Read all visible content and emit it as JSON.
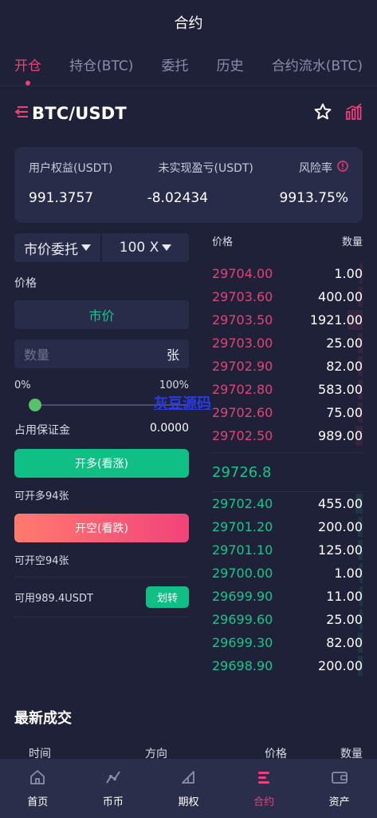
{
  "header": {
    "title": "合约"
  },
  "tabs": [
    {
      "label": "开仓",
      "active": true
    },
    {
      "label": "持仓(BTC)",
      "active": false
    },
    {
      "label": "委托",
      "active": false
    },
    {
      "label": "历史",
      "active": false
    },
    {
      "label": "合约流水(BTC)",
      "active": false
    }
  ],
  "pair": {
    "name": "BTC/USDT"
  },
  "account": {
    "equity_label": "用户权益(USDT)",
    "equity_value": "991.3757",
    "unrealized_label": "未实现盈亏(USDT)",
    "unrealized_value": "-8.02434",
    "risk_label": "风险率",
    "risk_value": "9913.75%"
  },
  "order_form": {
    "type_label": "市价委托",
    "leverage_label": "100 X",
    "price_label": "价格",
    "market_text": "市价",
    "qty_placeholder": "数量",
    "qty_unit": "张",
    "pct_min": "0%",
    "pct_max": "100%",
    "slider_value": 0,
    "margin_label": "占用保证金",
    "margin_value": "0.0000",
    "long_button": "开多(看涨)",
    "long_avail": "可开多94张",
    "short_button": "开空(看跌)",
    "short_avail": "可开空94张",
    "usable": "可用989.4USDT",
    "transfer_button": "划转"
  },
  "orderbook": {
    "price_header": "价格",
    "qty_header": "数量",
    "asks": [
      {
        "price": "29704.00",
        "qty": "1.00",
        "depth": 0.02
      },
      {
        "price": "29703.60",
        "qty": "400.00",
        "depth": 0.03
      },
      {
        "price": "29703.50",
        "qty": "1921.00",
        "depth": 0.1
      },
      {
        "price": "29703.00",
        "qty": "25.00",
        "depth": 0.03
      },
      {
        "price": "29702.90",
        "qty": "82.00",
        "depth": 0.03
      },
      {
        "price": "29702.80",
        "qty": "583.00",
        "depth": 0.03
      },
      {
        "price": "29702.60",
        "qty": "75.00",
        "depth": 0.03
      },
      {
        "price": "29702.50",
        "qty": "989.00",
        "depth": 0.05
      }
    ],
    "last_price": "29726.8",
    "bids": [
      {
        "price": "29702.40",
        "qty": "455.00",
        "depth": 0.05
      },
      {
        "price": "29701.20",
        "qty": "200.00",
        "depth": 0.03
      },
      {
        "price": "29701.10",
        "qty": "125.00",
        "depth": 0.03
      },
      {
        "price": "29700.00",
        "qty": "1.00",
        "depth": 0.02
      },
      {
        "price": "29699.90",
        "qty": "11.00",
        "depth": 0.02
      },
      {
        "price": "29699.60",
        "qty": "25.00",
        "depth": 0.02
      },
      {
        "price": "29699.30",
        "qty": "82.00",
        "depth": 0.03
      },
      {
        "price": "29698.90",
        "qty": "200.00",
        "depth": 0.03
      }
    ]
  },
  "watermark": "灰豆源码",
  "latest": {
    "title": "最新成交",
    "col_time": "时间",
    "col_direction": "方向",
    "col_price": "价格",
    "col_qty": "数量"
  },
  "nav": [
    {
      "label": "首页",
      "icon": "home-icon",
      "active": false
    },
    {
      "label": "币币",
      "icon": "chart-icon",
      "active": false
    },
    {
      "label": "期权",
      "icon": "triangle-icon",
      "active": false
    },
    {
      "label": "合约",
      "icon": "contract-icon",
      "active": true
    },
    {
      "label": "资产",
      "icon": "wallet-icon",
      "active": false
    }
  ],
  "colors": {
    "background": "#1f2139",
    "accent_pink": "#ef3f78",
    "up_green": "#19c58b",
    "down_red": "#e04477"
  }
}
